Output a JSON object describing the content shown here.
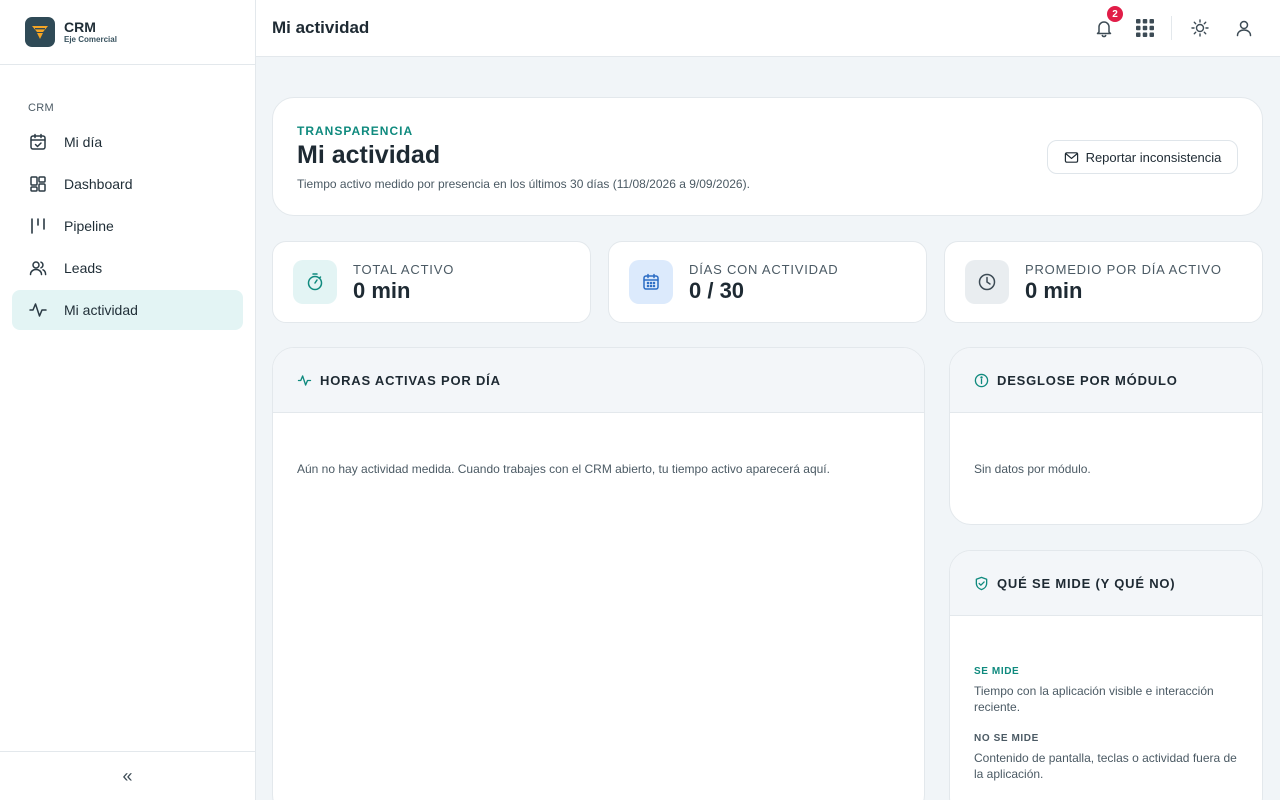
{
  "brand": {
    "name": "CRM",
    "subtitle": "Eje Comercial"
  },
  "sidebar": {
    "section_label": "CRM",
    "items": [
      {
        "label": "Mi día",
        "icon": "calendar-check-icon"
      },
      {
        "label": "Dashboard",
        "icon": "dashboard-grid-icon"
      },
      {
        "label": "Pipeline",
        "icon": "pipeline-icon"
      },
      {
        "label": "Leads",
        "icon": "users-icon"
      },
      {
        "label": "Mi actividad",
        "icon": "activity-icon",
        "active": true
      }
    ],
    "collapse_label": "«"
  },
  "topbar": {
    "title": "Mi actividad",
    "notification_count": "2"
  },
  "hero": {
    "kicker": "TRANSPARENCIA",
    "title": "Mi actividad",
    "description": "Tiempo activo medido por presencia en los últimos 30 días (11/08/2026 a 9/09/2026).",
    "report_button": "Reportar inconsistencia"
  },
  "stats": [
    {
      "label": "TOTAL ACTIVO",
      "value": "0 min",
      "icon": "stopwatch-icon"
    },
    {
      "label": "DÍAS CON ACTIVIDAD",
      "value": "0 / 30",
      "icon": "calendar-icon"
    },
    {
      "label": "PROMEDIO POR DÍA ACTIVO",
      "value": "0 min",
      "icon": "clock-icon"
    }
  ],
  "hours_panel": {
    "title": "HORAS ACTIVAS POR DÍA",
    "empty": "Aún no hay actividad medida. Cuando trabajes con el CRM abierto, tu tiempo activo aparecerá aquí."
  },
  "module_panel": {
    "title": "DESGLOSE POR MÓDULO",
    "empty": "Sin datos por módulo."
  },
  "measure_panel": {
    "title": "QUÉ SE MIDE (Y QUÉ NO)",
    "measured_label": "SE MIDE",
    "measured_text": "Tiempo con la aplicación visible e interacción reciente.",
    "not_measured_label": "NO SE MIDE",
    "not_measured_text": "Contenido de pantalla, teclas o actividad fuera de la aplicación."
  },
  "colors": {
    "accent": "#0f8a7e",
    "active_nav_bg": "#e3f4f4",
    "badge": "#e11d48",
    "brand_logo_bg": "#2f4a56",
    "brand_logo_accent": "#f5a524"
  }
}
